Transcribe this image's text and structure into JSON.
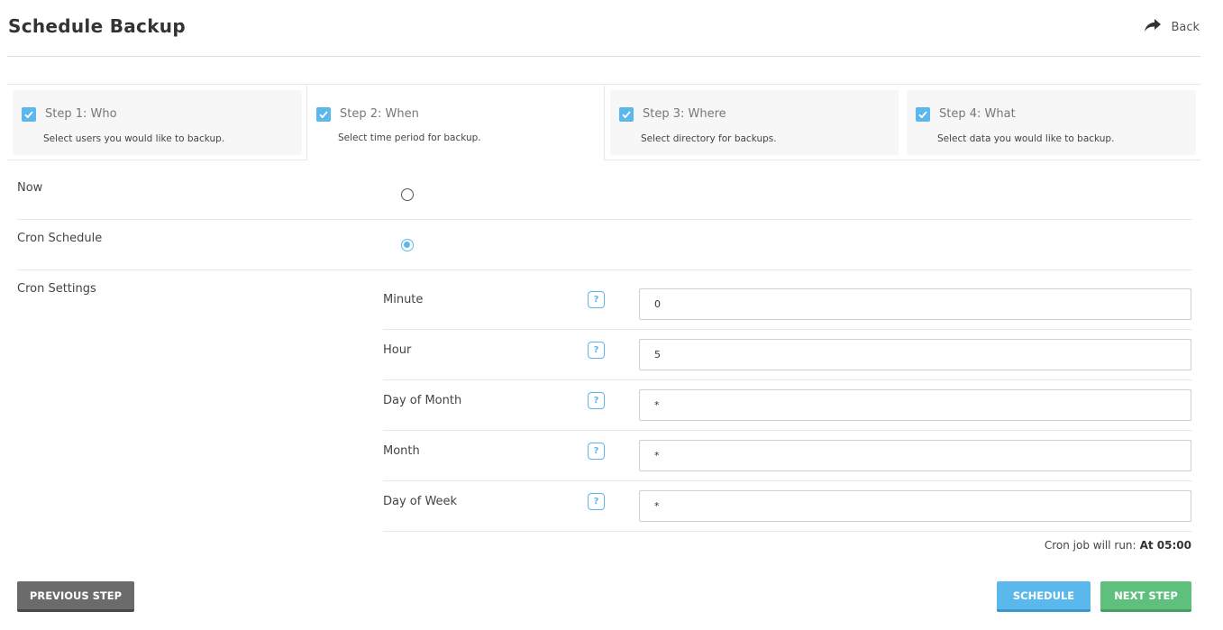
{
  "header": {
    "title": "Schedule Backup",
    "back_label": "Back"
  },
  "steps": [
    {
      "title": "Step 1: Who",
      "desc": "Select users you would like to backup.",
      "checked": true
    },
    {
      "title": "Step 2: When",
      "desc": "Select time period for backup.",
      "checked": true,
      "active": true
    },
    {
      "title": "Step 3: Where",
      "desc": "Select directory for backups.",
      "checked": true
    },
    {
      "title": "Step 4: What",
      "desc": "Select data you would like to backup.",
      "checked": true
    }
  ],
  "options": {
    "now_label": "Now",
    "cron_label": "Cron Schedule",
    "selected": "cron"
  },
  "cron": {
    "settings_label": "Cron Settings",
    "fields": [
      {
        "label": "Minute",
        "value": "0"
      },
      {
        "label": "Hour",
        "value": "5"
      },
      {
        "label": "Day of Month",
        "value": "*"
      },
      {
        "label": "Month",
        "value": "*"
      },
      {
        "label": "Day of Week",
        "value": "*"
      }
    ],
    "help_glyph": "?",
    "summary_label": "Cron job will run:",
    "summary_value": "At 05:00"
  },
  "buttons": {
    "previous": "PREVIOUS STEP",
    "schedule": "SCHEDULE",
    "next": "NEXT STEP"
  },
  "colors": {
    "accent": "#5bb8ec",
    "success": "#5fbf7d",
    "neutral": "#6b6b6b"
  },
  "icons": {
    "back": "share-arrow-icon",
    "step_check": "checkbox-checked-icon",
    "help": "help-icon"
  }
}
